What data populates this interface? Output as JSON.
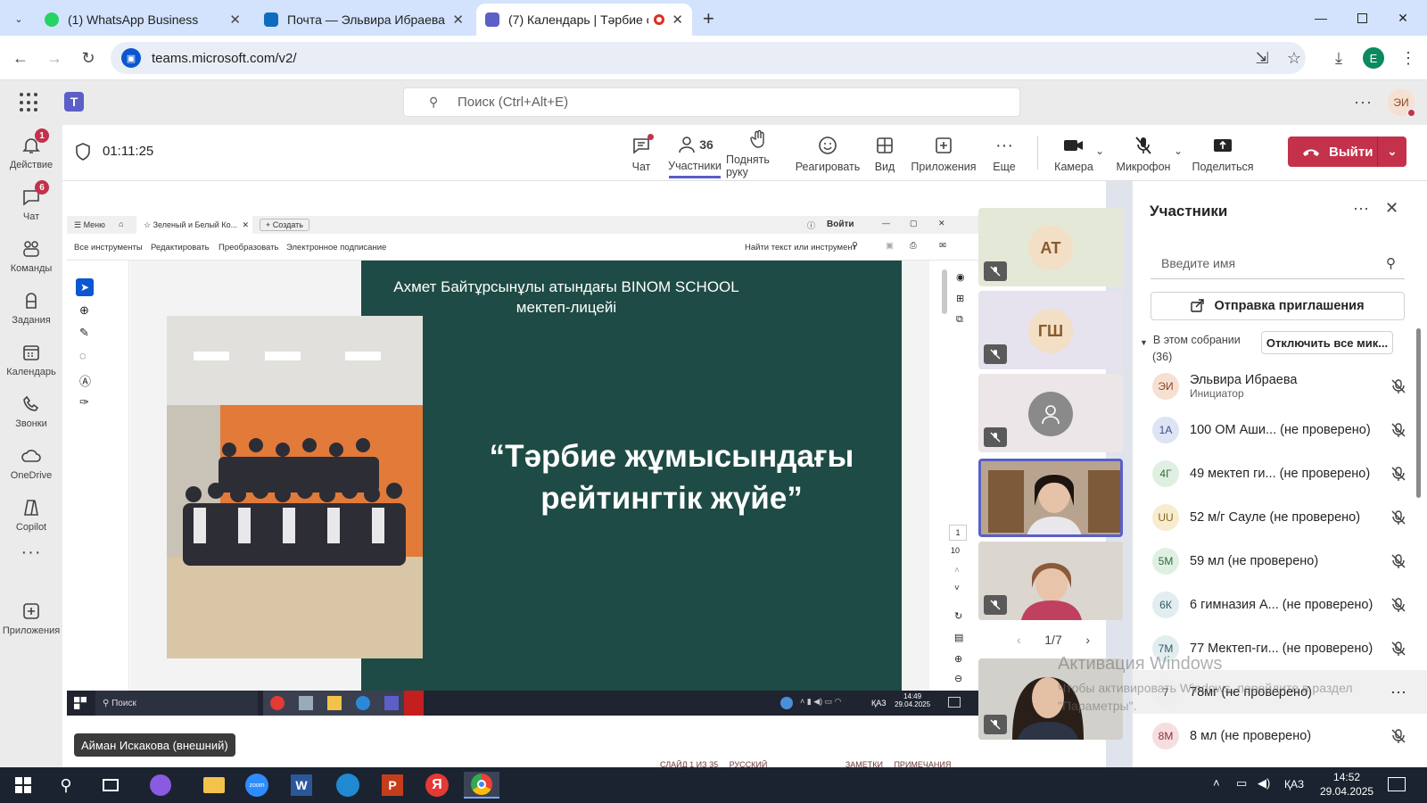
{
  "browser": {
    "tabs": [
      {
        "title": "(1) WhatsApp Business",
        "icon": "whatsapp-icon"
      },
      {
        "title": "Почта — Эльвира Ибраева —",
        "icon": "outlook-icon"
      },
      {
        "title": "(7) Календарь | Тәрбие орі",
        "icon": "teams-icon"
      }
    ],
    "new_tab": "+",
    "url": "teams.microsoft.com/v2/",
    "profile_initial": "E"
  },
  "teams": {
    "search_placeholder": "Поиск (Ctrl+Alt+E)",
    "user_initials": "ЭИ",
    "rail": [
      {
        "label": "Действие",
        "icon": "bell-icon",
        "badge": "1"
      },
      {
        "label": "Чат",
        "icon": "chat-icon",
        "badge": "6"
      },
      {
        "label": "Команды",
        "icon": "teams-group-icon",
        "badge": ""
      },
      {
        "label": "Задания",
        "icon": "assignments-icon",
        "badge": ""
      },
      {
        "label": "Календарь",
        "icon": "calendar-icon",
        "badge": ""
      },
      {
        "label": "Звонки",
        "icon": "phone-icon",
        "badge": ""
      },
      {
        "label": "OneDrive",
        "icon": "cloud-icon",
        "badge": ""
      },
      {
        "label": "Copilot",
        "icon": "copilot-icon",
        "badge": ""
      },
      {
        "label": "",
        "icon": "more-icon",
        "badge": ""
      },
      {
        "label": "Приложения",
        "icon": "add-app-icon",
        "badge": ""
      }
    ]
  },
  "meeting": {
    "timer": "01:11:25",
    "participants_count": "36",
    "toolbar": {
      "chat": "Чат",
      "participants": "Участники",
      "raise_hand": "Поднять руку",
      "react": "Реагировать",
      "view": "Вид",
      "apps": "Приложения",
      "more": "Еще",
      "camera": "Камера",
      "mic": "Микрофон",
      "share": "Поделиться",
      "leave": "Выйти"
    },
    "presenter_label": "Айман Искакова (внешний)",
    "gallery_page": "1/7",
    "tiles": [
      {
        "initials": "АТ"
      },
      {
        "initials": "ГШ"
      },
      {
        "initials": ""
      }
    ]
  },
  "shared_screen": {
    "viewer_menu": "Меню",
    "viewer_tab": "Зеленый и Белый Ко...",
    "viewer_create": "Создать",
    "viewer_signin": "Войти",
    "viewer_tools": [
      "Все инструменты",
      "Редактировать",
      "Преобразовать",
      "Электронное подписание"
    ],
    "viewer_find": "Найти текст или инструмент",
    "page_current": "1",
    "page_total": "10",
    "slide": {
      "header_line1": "Ахмет Байтұрсынұлы атындағы BINOM SCHOOL",
      "header_line2": "мектеп-лицейі",
      "title_line1": "“Тәрбие жұмысындағы",
      "title_line2": "рейтингтік жүйе”"
    },
    "inner_taskbar": {
      "search": "Поиск",
      "lang": "ҚАЗ",
      "time": "14:49",
      "date": "29.04.2025"
    }
  },
  "panel": {
    "title": "Участники",
    "search_placeholder": "Введите имя",
    "invite": "Отправка приглашения",
    "section_label": "В этом собрании",
    "section_count": "(36)",
    "mute_all": "Отключить все мик...",
    "participants": [
      {
        "initials": "ЭИ",
        "name": "Эльвира Ибраева",
        "sub": "Инициатор",
        "color": "#f6e0d2",
        "text": "#8a4a2a"
      },
      {
        "initials": "1А",
        "name": "100 ОМ Аши...  (не проверено)",
        "sub": "",
        "color": "#dde4f4",
        "text": "#3b4f8a"
      },
      {
        "initials": "4Г",
        "name": "49 мектеп ги...  (не проверено)",
        "sub": "",
        "color": "#dff0e2",
        "text": "#2f6a3a"
      },
      {
        "initials": "UU",
        "name": "52 м/г Сауле (не проверено)",
        "sub": "",
        "color": "#f7ecd0",
        "text": "#8a6a1a"
      },
      {
        "initials": "5M",
        "name": "59 мл (не проверено)",
        "sub": "",
        "color": "#dff0e2",
        "text": "#2f6a3a"
      },
      {
        "initials": "6К",
        "name": "6 гимназия А...  (не проверено)",
        "sub": "",
        "color": "#e2edf0",
        "text": "#2f5a66"
      },
      {
        "initials": "7М",
        "name": "77 Мектеп-ги...  (не проверено)",
        "sub": "",
        "color": "#e2edf0",
        "text": "#2f5a66"
      },
      {
        "initials": "7",
        "name": "78мг (не проверено)",
        "sub": "",
        "color": "#eeeeee",
        "text": "#444444"
      },
      {
        "initials": "8М",
        "name": "8 мл (не проверено)",
        "sub": "",
        "color": "#f6dde0",
        "text": "#8a2f3a"
      }
    ],
    "watermark_line1": "Активация Windows",
    "watermark_line2": "Чтобы активировать Windows, перейдите в раздел",
    "watermark_line3": "\"Параметры\"."
  },
  "os": {
    "time": "14:52",
    "date": "29.04.2025",
    "lang": "ҚАЗ",
    "behind_text": "СЛАЙД 1 ИЗ 35     РУССКИЙ                                   ЗАМЕТКИ     ПРИМЕЧАНИЯ"
  }
}
